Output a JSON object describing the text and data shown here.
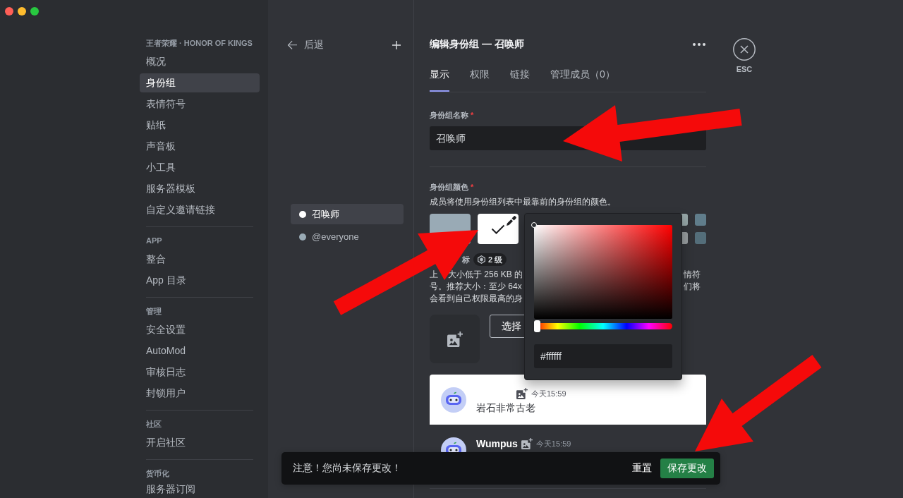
{
  "window": {
    "controls": [
      {
        "kind": "close"
      },
      {
        "kind": "minimize"
      },
      {
        "kind": "zoom"
      }
    ]
  },
  "sidebar": {
    "sections": [
      {
        "header": "王者荣耀 · HONOR OF KINGS",
        "items": [
          {
            "label": "概况",
            "selected": false
          },
          {
            "label": "身份组",
            "selected": true
          },
          {
            "label": "表情符号",
            "selected": false
          },
          {
            "label": "贴纸",
            "selected": false
          },
          {
            "label": "声音板",
            "selected": false
          },
          {
            "label": "小工具",
            "selected": false
          },
          {
            "label": "服务器模板",
            "selected": false
          },
          {
            "label": "自定义邀请链接",
            "selected": false
          }
        ]
      },
      {
        "header": "APP",
        "items": [
          {
            "label": "整合",
            "selected": false
          },
          {
            "label": "App 目录",
            "selected": false
          }
        ]
      },
      {
        "header": "管理",
        "items": [
          {
            "label": "安全设置",
            "selected": false
          },
          {
            "label": "AutoMod",
            "selected": false
          },
          {
            "label": "审核日志",
            "selected": false
          },
          {
            "label": "封锁用户",
            "selected": false
          }
        ]
      },
      {
        "header": "社区",
        "items": [
          {
            "label": "开启社区",
            "selected": false
          }
        ]
      },
      {
        "header": "货币化",
        "items": [
          {
            "label": "服务器订阅",
            "selected": false
          }
        ]
      }
    ]
  },
  "roles_panel": {
    "back_label": "后退",
    "roles": [
      {
        "name": "召唤师",
        "color": "#ffffff",
        "selected": true
      },
      {
        "name": "@everyone",
        "color": "#99aab5",
        "selected": false
      }
    ]
  },
  "editor": {
    "title": "编辑身份组 — 召唤师",
    "tabs": [
      {
        "label": "显示",
        "selected": true
      },
      {
        "label": "权限",
        "selected": false
      },
      {
        "label": "链接",
        "selected": false
      },
      {
        "label": "管理成员（0）",
        "selected": false
      }
    ],
    "name_field": {
      "label": "身份组名称",
      "required_mark": "*",
      "value": "召唤师"
    },
    "color_field": {
      "label": "身份组颜色",
      "required_mark": "*",
      "description": "成员将使用身份组列表中最靠前的身份组的颜色。",
      "swatches": [
        {
          "kind": "default",
          "color": "#99aab5",
          "selected": false
        },
        {
          "kind": "custom",
          "color": "#ffffff",
          "selected": true
        }
      ],
      "preset_swatches": [
        {
          "color": "#95a5a6"
        },
        {
          "color": "#607d8b"
        },
        {
          "color": "#979c9f"
        },
        {
          "color": "#546e7a"
        }
      ],
      "picker": {
        "hue": {
          "level": 0
        },
        "hex_value": "#ffffff"
      }
    },
    "icon_field": {
      "label": "标",
      "badge": "2 级",
      "description_lines": [
        {
          "left": [
            "上",
            "大小低于 256 KB 的"
          ],
          "right": "情符"
        },
        {
          "left": [
            "号。推荐大小：至少 64x"
          ],
          "right": "们将"
        },
        {
          "left": [
            "会看到自己权限最高的身"
          ]
        }
      ],
      "upload_button": "选择"
    },
    "preview": [
      {
        "kind": "light",
        "time": "今天15:59",
        "message": "岩石非常古老"
      },
      {
        "kind": "dark",
        "author": "Wumpus",
        "time": "今天15:59"
      }
    ]
  },
  "close": {
    "label": "ESC"
  },
  "notice_bar": {
    "message": "注意！您尚未保存更改！",
    "reset_label": "重置",
    "save_label": "保存更改"
  },
  "annotations": [
    {
      "kind": "arrow"
    },
    {
      "kind": "arrow"
    },
    {
      "kind": "arrow"
    }
  ]
}
